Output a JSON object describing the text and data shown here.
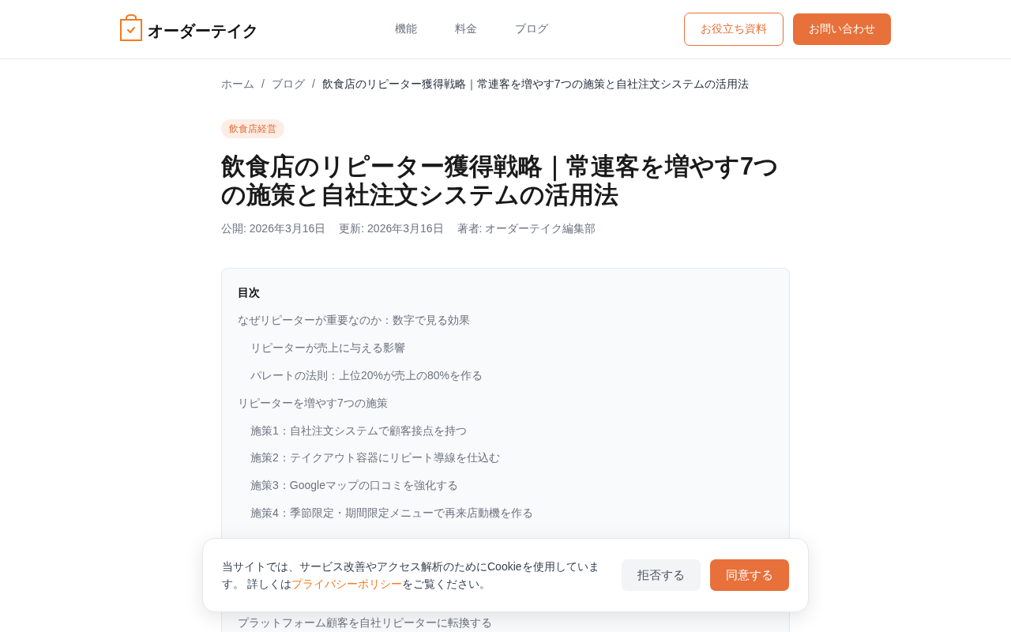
{
  "header": {
    "logo": {
      "name": "オーダーテイク"
    },
    "nav": [
      {
        "label": "機能"
      },
      {
        "label": "料金"
      },
      {
        "label": "ブログ"
      }
    ],
    "buttons": [
      {
        "label": "お役立ち資料",
        "kind": "outline"
      },
      {
        "label": "お問い合わせ",
        "kind": "primary"
      }
    ]
  },
  "breadcrumb": [
    {
      "label": "ホーム",
      "kind": "link"
    },
    {
      "label": "/",
      "kind": "separator"
    },
    {
      "label": "ブログ",
      "kind": "link"
    },
    {
      "label": "/",
      "kind": "separator"
    },
    {
      "label": "飲食店のリピーター獲得戦略｜常連客を増やす7つの施策と自社注文システムの活用法",
      "kind": "current"
    }
  ],
  "article": {
    "category": "飲食店経営",
    "title": "飲食店のリピーター獲得戦略｜常連客を増やす7つの施策と自社注文システムの活用法",
    "meta": [
      "公開: 2026年3月16日",
      "更新: 2026年3月16日",
      "著者: オーダーテイク編集部"
    ]
  },
  "toc": {
    "heading": "目次",
    "items": [
      {
        "label": "なぜリピーターが重要なのか：数字で見る効果",
        "children": [
          {
            "label": "リピーターが売上に与える影響"
          },
          {
            "label": "パレートの法則：上位20%が売上の80%を作る"
          }
        ]
      },
      {
        "label": "リピーターを増やす7つの施策",
        "children": [
          {
            "label": "施策1：自社注文システムで顧客接点を持つ"
          },
          {
            "label": "施策2：テイクアウト容器にリピート導線を仕込む"
          },
          {
            "label": "施策3：Googleマップの口コミを強化する"
          },
          {
            "label": "施策4：季節限定・期間限定メニューで再来店動機を作る"
          }
        ]
      },
      {
        "label": "プラットフォーム顧客を自社リピーターに転換する"
      }
    ]
  },
  "cookie_banner": {
    "text_before": "当サイトでは、サービス改善やアクセス解析のためにCookieを使用しています。 詳しくは",
    "link": "プライバシーポリシー",
    "text_after": "をご覧ください。",
    "buttons": [
      {
        "label": "拒否する",
        "kind": "secondary"
      },
      {
        "label": "同意する",
        "kind": "primary"
      }
    ]
  }
}
